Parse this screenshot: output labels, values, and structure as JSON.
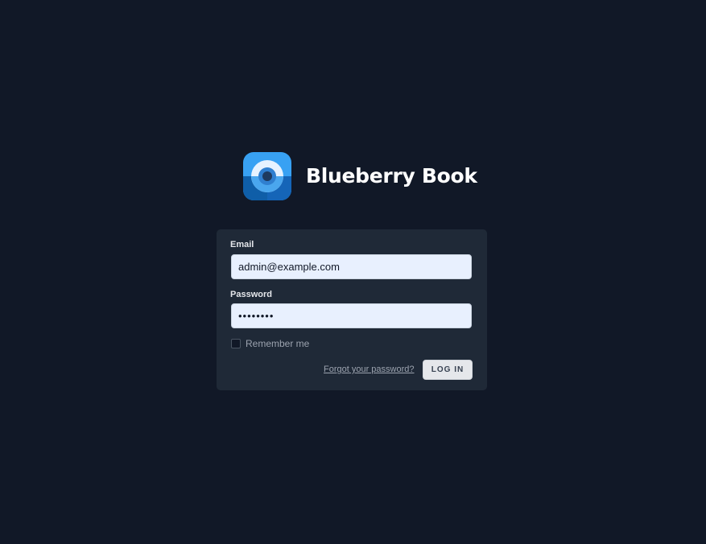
{
  "brand": {
    "name": "Blueberry Book",
    "logo_icon": "blueberry-logo-icon",
    "logo_colors": [
      "#38a1f3",
      "#0f5ea8",
      "#1e3a5f",
      "#e6f2ff"
    ]
  },
  "form": {
    "email_label": "Email",
    "email_value": "admin@example.com",
    "password_label": "Password",
    "password_value": "password",
    "remember_label": "Remember me",
    "remember_checked": false,
    "forgot_link": "Forgot your password?",
    "login_button": "LOG IN"
  },
  "colors": {
    "background": "#111827",
    "card": "#1f2937",
    "input_fill": "#e8f0fe"
  }
}
